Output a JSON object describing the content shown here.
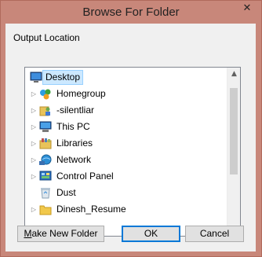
{
  "window": {
    "title": "Browse For Folder",
    "close_glyph": "✕"
  },
  "description": "Output Location",
  "tree": {
    "items": [
      {
        "label": "Desktop",
        "icon": "desktop-icon",
        "expander": false,
        "selected": true
      },
      {
        "label": "Homegroup",
        "icon": "homegroup-icon",
        "expander": true
      },
      {
        "label": "-silentliar",
        "icon": "user-folder-icon",
        "expander": true
      },
      {
        "label": "This PC",
        "icon": "computer-icon",
        "expander": true
      },
      {
        "label": "Libraries",
        "icon": "libraries-icon",
        "expander": true
      },
      {
        "label": "Network",
        "icon": "network-icon",
        "expander": true
      },
      {
        "label": "Control Panel",
        "icon": "control-panel-icon",
        "expander": true
      },
      {
        "label": "Dust",
        "icon": "recycle-bin-icon",
        "expander": false
      },
      {
        "label": "Dinesh_Resume",
        "icon": "folder-icon",
        "expander": true
      }
    ]
  },
  "buttons": {
    "make_new_folder_prefix": "M",
    "make_new_folder_rest": "ake New Folder",
    "ok": "OK",
    "cancel": "Cancel"
  }
}
